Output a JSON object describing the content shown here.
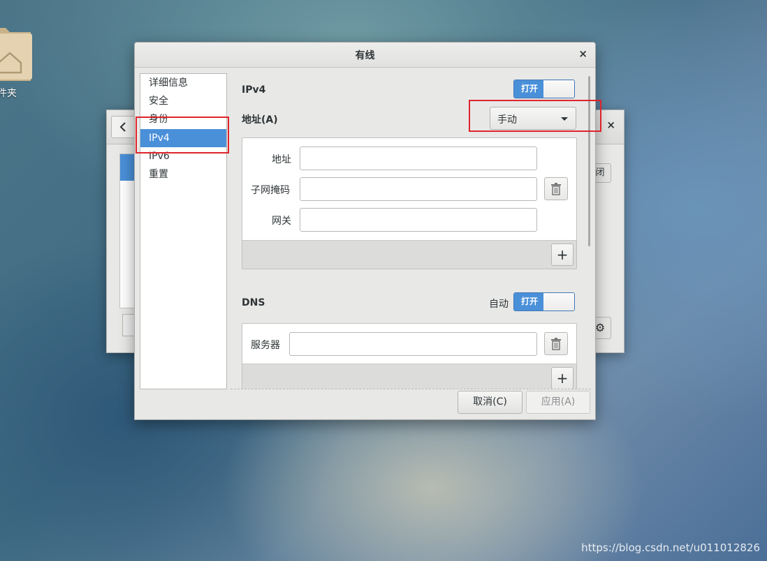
{
  "desktop": {
    "folder_label": "文件夹",
    "watermark": "https://blog.csdn.net/u011012826"
  },
  "background_window": {
    "close_label": "闭"
  },
  "dialog": {
    "title": "有线",
    "sidebar": [
      {
        "label": "详细信息",
        "selected": false
      },
      {
        "label": "安全",
        "selected": false
      },
      {
        "label": "身份",
        "selected": false
      },
      {
        "label": "IPv4",
        "selected": true
      },
      {
        "label": "IPv6",
        "selected": false
      },
      {
        "label": "重置",
        "selected": false
      }
    ],
    "ipv4": {
      "heading": "IPv4",
      "switch_label": "打开",
      "address_method_label": "地址(A)",
      "address_method_value": "手动",
      "fields": {
        "address_label": "地址",
        "netmask_label": "子网掩码",
        "gateway_label": "网关"
      }
    },
    "dns": {
      "heading": "DNS",
      "auto_label": "自动",
      "switch_label": "打开",
      "server_label": "服务器"
    },
    "buttons": {
      "cancel": "取消(C)",
      "apply": "应用(A)"
    }
  },
  "colors": {
    "accent": "#4a90d9",
    "annotation": "#e0242b"
  }
}
